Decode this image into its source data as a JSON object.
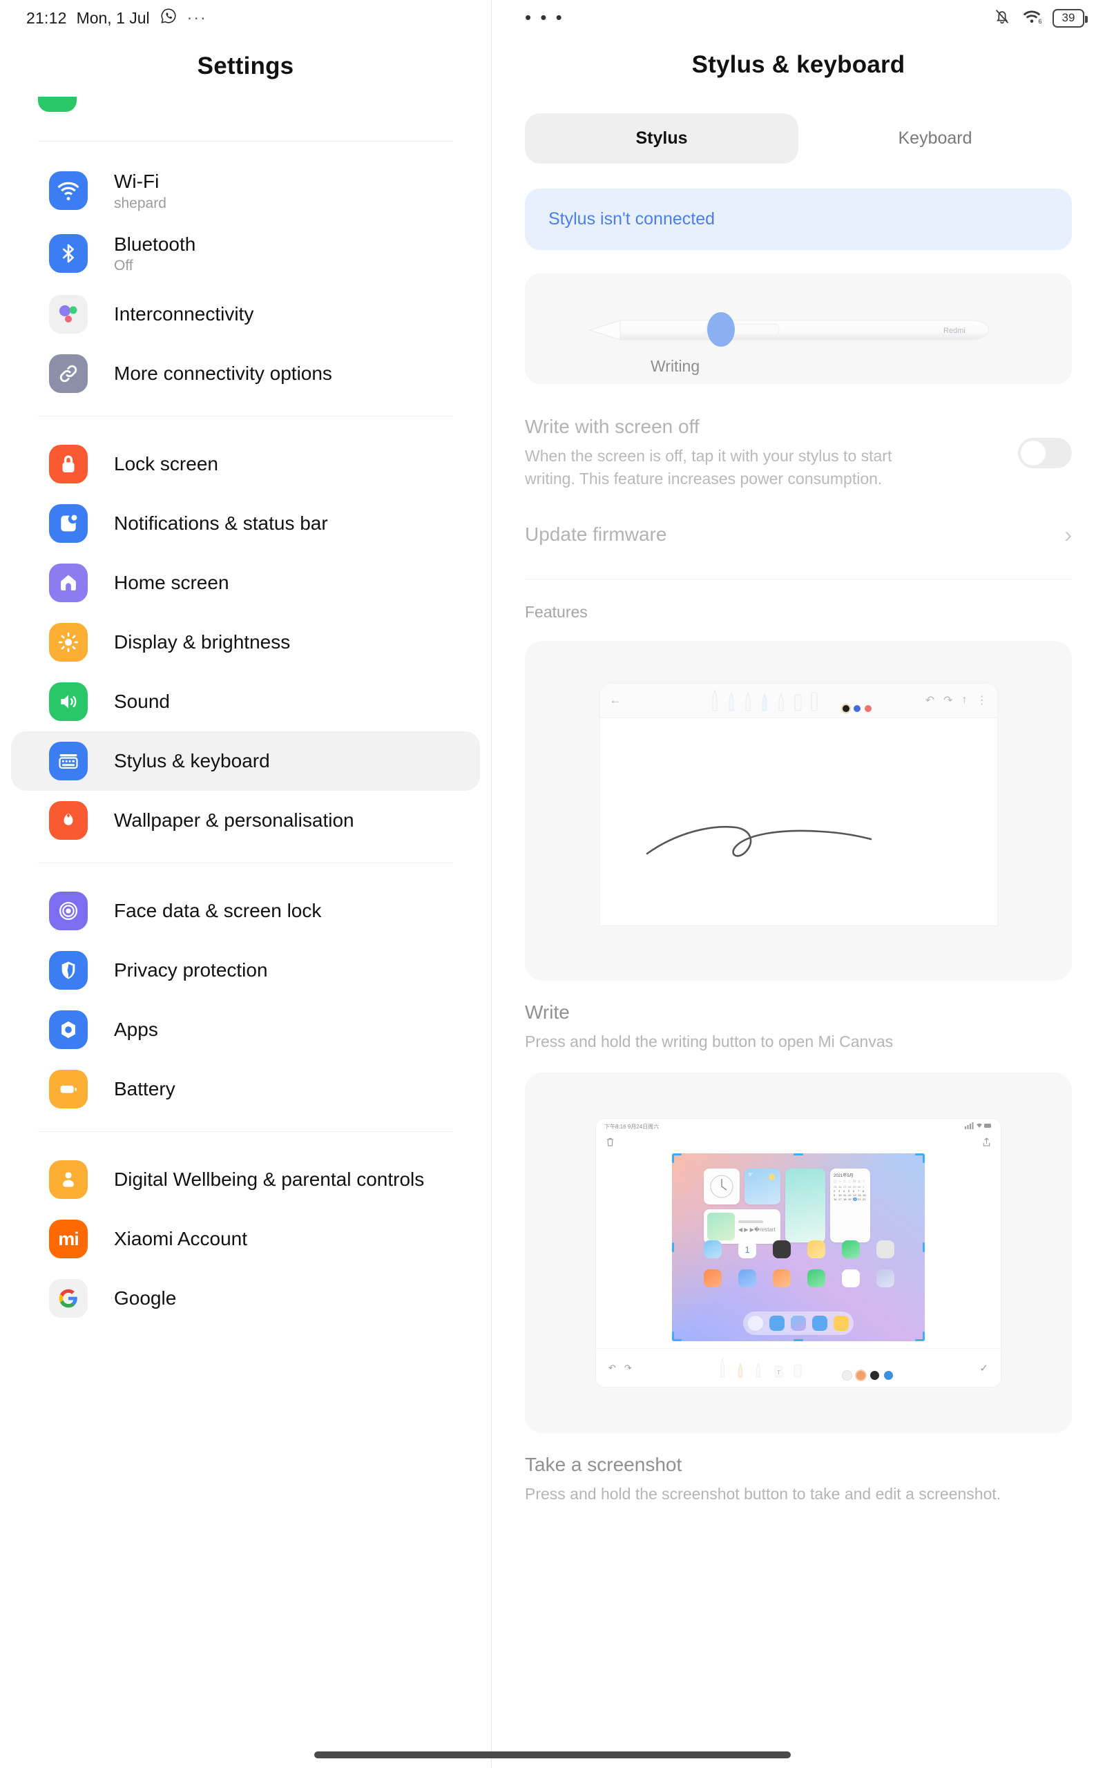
{
  "status_bar": {
    "time": "21:12",
    "date": "Mon, 1 Jul",
    "left_overflow": "···",
    "right_overflow": "• • •",
    "battery_level": "39",
    "wifi_generation": "6"
  },
  "sidebar": {
    "title": "Settings",
    "partial_top_item_label": "",
    "items": [
      {
        "label": "Wi-Fi",
        "sub": "shepard",
        "icon": "wifi-icon",
        "color": "#3b7ef4"
      },
      {
        "label": "Bluetooth",
        "sub": "Off",
        "icon": "bluetooth-icon",
        "color": "#3b7ef4"
      },
      {
        "label": "Interconnectivity",
        "sub": "",
        "icon": "interconnectivity-icon",
        "color": "#f0f0f0"
      },
      {
        "label": "More connectivity options",
        "sub": "",
        "icon": "link-icon",
        "color": "#8b90a8"
      },
      {
        "label": "Lock screen",
        "sub": "",
        "icon": "lock-icon",
        "color": "#fa5a31"
      },
      {
        "label": "Notifications & status bar",
        "sub": "",
        "icon": "notification-icon",
        "color": "#3b7ef4"
      },
      {
        "label": "Home screen",
        "sub": "",
        "icon": "home-icon",
        "color": "#8b7cf0"
      },
      {
        "label": "Display & brightness",
        "sub": "",
        "icon": "brightness-icon",
        "color": "#fcae35"
      },
      {
        "label": "Sound",
        "sub": "",
        "icon": "speaker-icon",
        "color": "#2ac769"
      },
      {
        "label": "Stylus & keyboard",
        "sub": "",
        "icon": "keyboard-icon",
        "color": "#3b7ef4"
      },
      {
        "label": "Wallpaper & personalisation",
        "sub": "",
        "icon": "flower-icon",
        "color": "#fa5a31"
      },
      {
        "label": "Face data & screen lock",
        "sub": "",
        "icon": "fingerprint-icon",
        "color": "#7b6ef0"
      },
      {
        "label": "Privacy protection",
        "sub": "",
        "icon": "shield-icon",
        "color": "#3b7ef4"
      },
      {
        "label": "Apps",
        "sub": "",
        "icon": "apps-icon",
        "color": "#3b7ef4"
      },
      {
        "label": "Battery",
        "sub": "",
        "icon": "battery-icon",
        "color": "#fcae35"
      },
      {
        "label": "Digital Wellbeing & parental controls",
        "sub": "",
        "icon": "wellbeing-icon",
        "color": "#fcae35"
      },
      {
        "label": "Xiaomi Account",
        "sub": "",
        "icon": "xiaomi-icon",
        "color": "#ff6900"
      },
      {
        "label": "Google",
        "sub": "",
        "icon": "google-icon",
        "color": "#f1f1f1"
      }
    ],
    "selected_label": "Stylus & keyboard"
  },
  "detail": {
    "title": "Stylus & keyboard",
    "tabs": [
      {
        "label": "Stylus",
        "active": true
      },
      {
        "label": "Keyboard",
        "active": false
      }
    ],
    "banner": "Stylus isn't connected",
    "stylus_card": {
      "brand": "Redmi",
      "button_label": "Writing"
    },
    "write_screen_off": {
      "title": "Write with screen off",
      "description": "When the screen is off, tap it with your stylus to start writing. This feature increases power consumption.",
      "toggle_on": false
    },
    "update_firmware": {
      "label": "Update firmware",
      "chevron": "›"
    },
    "features_label": "Features",
    "features": [
      {
        "title": "Write",
        "description": "Press and hold the writing button to open Mi Canvas",
        "illustration": "mi-canvas-illustration"
      },
      {
        "title": "Take a screenshot",
        "description": "Press and hold the screenshot button to take and edit a screenshot.",
        "illustration": "screenshot-editor-illustration"
      }
    ],
    "canvas_mock": {
      "back": "←",
      "undo": "↶",
      "redo": "↷",
      "share": "↑",
      "more": "⋮",
      "colors": [
        "#1d1d1d",
        "#3f6fdb",
        "#f2726f"
      ]
    },
    "screenshot_mock": {
      "status_time": "下午8:16  9月24日周六",
      "delete": "Ὕ1",
      "share": "↑",
      "undo": "↶",
      "redo": "↷",
      "confirm": "✓",
      "colors": [
        "#f2a06b",
        "#2b2b2b",
        "#3f8fe0"
      ]
    }
  },
  "colors": {
    "accent_blue": "#3b7ef4",
    "banner_bg": "#e8f0fe",
    "banner_text": "#4b7fe8",
    "card_bg": "#f7f7f7",
    "selected_bg": "#f2f2f2",
    "disabled_text": "#b3b3b3"
  }
}
